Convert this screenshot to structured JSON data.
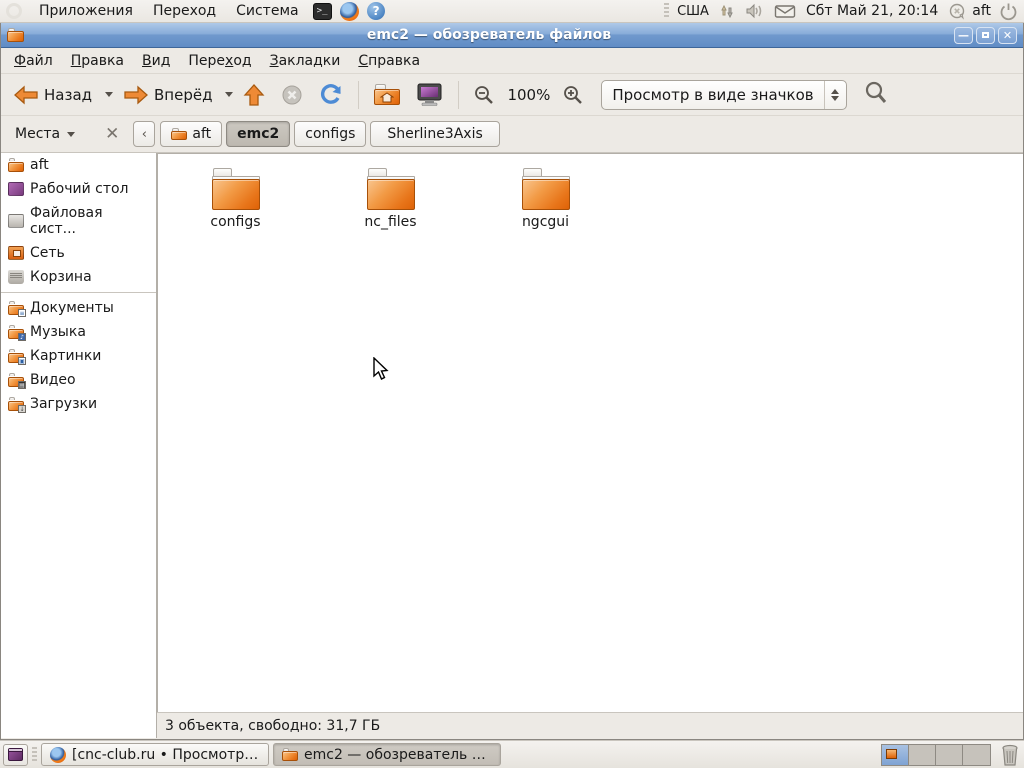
{
  "top_panel": {
    "menus": [
      {
        "label": "Приложения"
      },
      {
        "label": "Переход"
      },
      {
        "label": "Система"
      }
    ],
    "launcher_icons": [
      "terminal-icon",
      "firefox-icon",
      "help-icon"
    ],
    "keyboard_layout": "США",
    "indicator_icons": [
      "keyboard-updates-icon",
      "volume-icon",
      "mail-icon"
    ],
    "clock": "Сбт Май 21, 20:14",
    "me_menu": {
      "username": "aft",
      "icon": "status-bubble-icon"
    },
    "power_icon": "power-icon"
  },
  "window": {
    "title": "emc2 — обозреватель файлов",
    "title_icon": "file-manager-icon",
    "controls": {
      "minimize": "—",
      "maximize": "□",
      "close": "×"
    },
    "menubar": [
      {
        "pre": "",
        "key": "Ф",
        "post": "айл"
      },
      {
        "pre": "",
        "key": "П",
        "post": "равка"
      },
      {
        "pre": "",
        "key": "В",
        "post": "ид"
      },
      {
        "pre": "Пере",
        "key": "х",
        "post": "од"
      },
      {
        "pre": "",
        "key": "З",
        "post": "акладки"
      },
      {
        "pre": "",
        "key": "С",
        "post": "правка"
      }
    ],
    "toolbar": {
      "back_label": "Назад",
      "forward_label": "Вперёд",
      "icons": [
        "back-arrow-icon",
        "forward-arrow-icon",
        "up-arrow-icon",
        "stop-icon",
        "reload-icon",
        "home-folder-icon",
        "computer-icon",
        "zoom-out-icon",
        "zoom-in-icon",
        "search-icon"
      ],
      "zoom_level": "100%",
      "view_mode": "Просмотр в виде значков"
    },
    "pathbar": {
      "places_label": "Места",
      "close_icon": "×",
      "prev_icon": "‹",
      "breadcrumbs": [
        {
          "label": "aft"
        },
        {
          "label": "emc2"
        },
        {
          "label": "configs"
        },
        {
          "label": "Sherline3Axis"
        }
      ]
    },
    "sidebar": {
      "items": [
        {
          "label": "aft",
          "icon": "home-folder-icon"
        },
        {
          "label": "Рабочий стол",
          "icon": "desktop-icon"
        },
        {
          "label": "Файловая сист...",
          "icon": "filesystem-disk-icon"
        },
        {
          "label": "Сеть",
          "icon": "network-icon"
        },
        {
          "label": "Корзина",
          "icon": "trash-icon"
        },
        {
          "label": "Документы",
          "icon": "documents-folder-icon"
        },
        {
          "label": "Музыка",
          "icon": "music-folder-icon"
        },
        {
          "label": "Картинки",
          "icon": "pictures-folder-icon"
        },
        {
          "label": "Видео",
          "icon": "video-folder-icon"
        },
        {
          "label": "Загрузки",
          "icon": "downloads-folder-icon"
        }
      ]
    },
    "files": [
      {
        "name": "configs",
        "icon": "folder-icon"
      },
      {
        "name": "nc_files",
        "icon": "folder-icon"
      },
      {
        "name": "ngcgui",
        "icon": "folder-icon"
      }
    ],
    "statusbar_text": "3 объекта, свободно: 31,7 ГБ"
  },
  "taskbar": {
    "tasks": [
      {
        "label": "[cnc-club.ru • Просмотр т...",
        "icon": "firefox-icon",
        "active": false
      },
      {
        "label": "emc2 — обозреватель фа...",
        "icon": "file-manager-icon",
        "active": true
      }
    ],
    "workspace_count": 4,
    "trash_icon": "trash-icon"
  }
}
